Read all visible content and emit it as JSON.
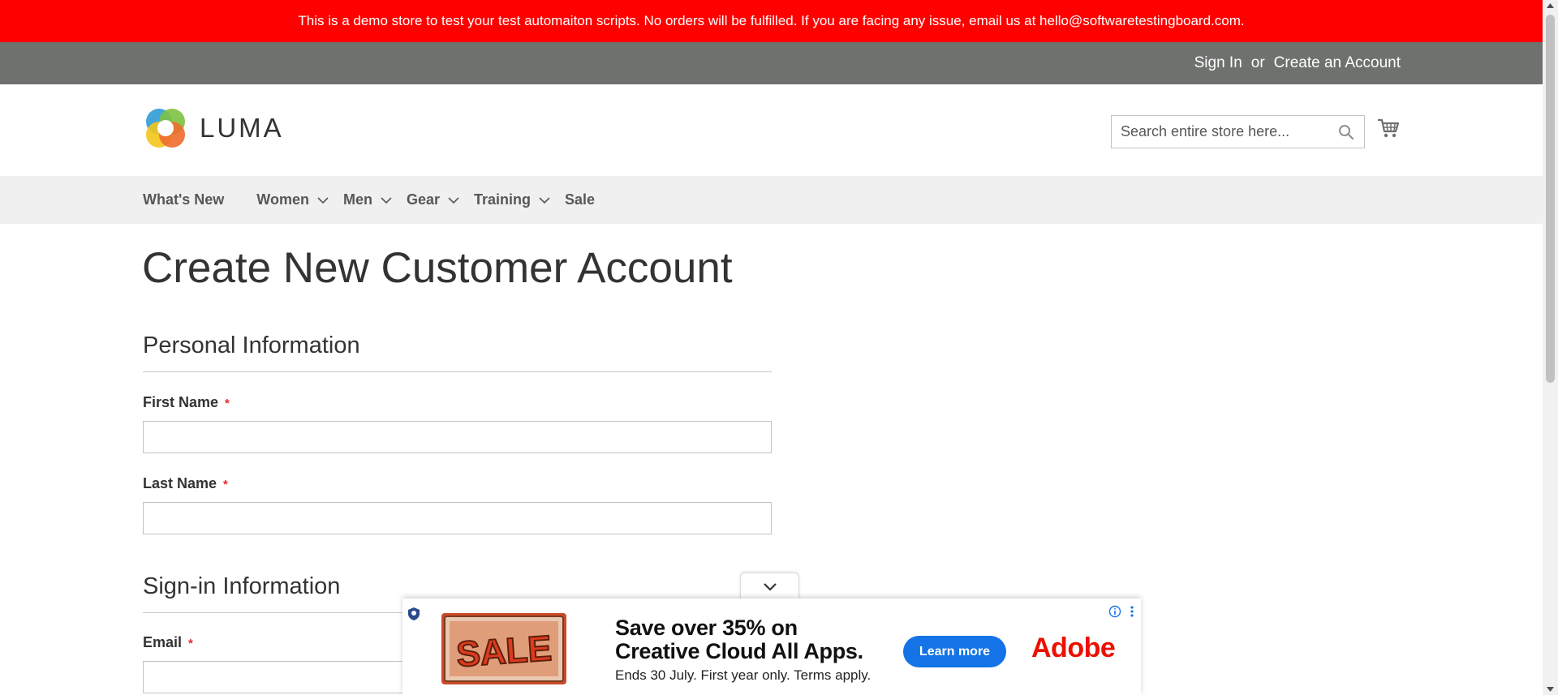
{
  "demo_notice": "This is a demo store to test your test automaiton scripts. No orders will be fulfilled. If you are facing any issue, email us at hello@softwaretestingboard.com.",
  "header_links": {
    "sign_in": "Sign In",
    "separator": "or",
    "create_account": "Create an Account"
  },
  "logo": {
    "text": "LUMA",
    "icon": "luma-logo-icon"
  },
  "search": {
    "placeholder": "Search entire store here...",
    "value": "",
    "icon": "search-icon"
  },
  "cart": {
    "icon": "cart-icon"
  },
  "nav": {
    "items": [
      {
        "label": "What's New",
        "has_submenu": false
      },
      {
        "label": "Women",
        "has_submenu": true
      },
      {
        "label": "Men",
        "has_submenu": true
      },
      {
        "label": "Gear",
        "has_submenu": true
      },
      {
        "label": "Training",
        "has_submenu": true
      },
      {
        "label": "Sale",
        "has_submenu": false
      }
    ]
  },
  "page": {
    "title": "Create New Customer Account",
    "personal_section": "Personal Information",
    "signin_section": "Sign-in Information",
    "fields": {
      "first_name": {
        "label": "First Name",
        "required_mark": "*",
        "value": ""
      },
      "last_name": {
        "label": "Last Name",
        "required_mark": "*",
        "value": ""
      },
      "email": {
        "label": "Email",
        "required_mark": "*",
        "value": ""
      }
    }
  },
  "ad": {
    "image_text": "SALE",
    "headline_line1": "Save over 35% on",
    "headline_line2": "Creative Cloud All Apps.",
    "subtext": "Ends 30 July. First year only. Terms apply.",
    "button_label": "Learn more",
    "brand": "Adobe",
    "colors": {
      "button": "#1473e6",
      "brand": "#eb1000"
    }
  },
  "colors": {
    "demo_bar": "#ff0000",
    "panel_header": "#6e716e",
    "nav_bg": "#f0f0f0",
    "required": "#e02b27"
  }
}
